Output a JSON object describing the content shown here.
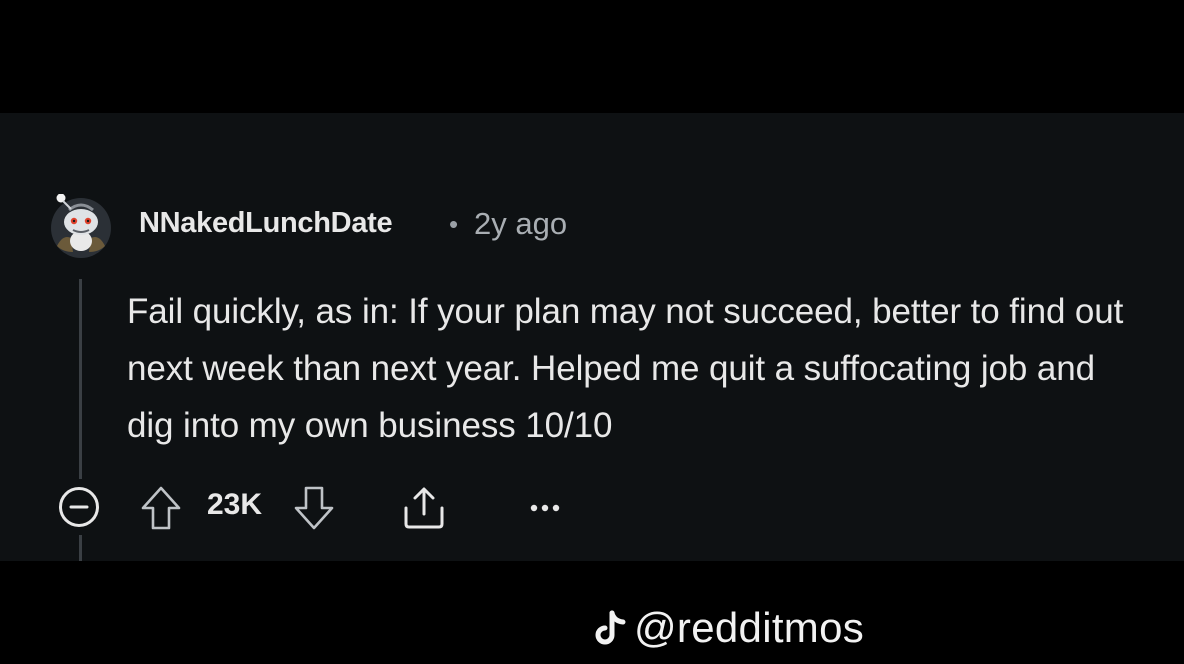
{
  "comment": {
    "username": "NNakedLunchDate",
    "separator": "•",
    "timestamp": "2y ago",
    "body": "Fail quickly, as in: If your plan may not succeed, better to find out next week than next year. Helped me quit a suffocating job and dig into my own business 10/10",
    "vote_count": "23K",
    "avatar_icon": "snoo-avatar-icon"
  },
  "actions": {
    "collapse_icon": "collapse-minus-icon",
    "upvote_icon": "upvote-arrow-icon",
    "downvote_icon": "downvote-arrow-icon",
    "share_icon": "share-icon",
    "more_icon": "more-options-icon"
  },
  "watermark": {
    "icon": "tiktok-icon",
    "handle": "@redditmos"
  },
  "colors": {
    "panel_background": "#0e1113",
    "outer_background": "#000000",
    "text_primary": "#e8e8e8",
    "text_secondary": "#a9aeb3",
    "thread_line": "#3a3f44"
  }
}
